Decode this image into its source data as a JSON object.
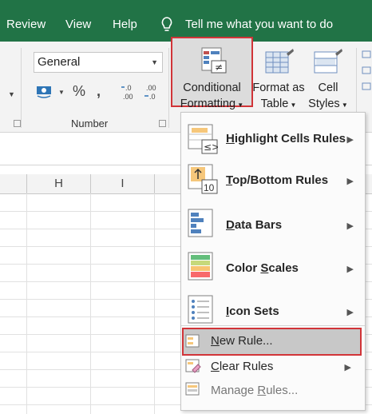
{
  "tabs": [
    "Review",
    "View",
    "Help"
  ],
  "tell_me": "Tell me what you want to do",
  "number_group": {
    "format_value": "General",
    "currency_symbol": "$",
    "percent_symbol": "%",
    "comma_symbol": ",",
    "increase_decimal": "←.0\n.00",
    "decrease_decimal": ".00\n→.0",
    "label": "Number"
  },
  "styles_group": {
    "conditional_formatting": [
      "Conditional",
      "Formatting"
    ],
    "format_as_table": [
      "Format as",
      "Table"
    ],
    "cell_styles": [
      "Cell",
      "Styles"
    ]
  },
  "column_headers": [
    "H",
    "I"
  ],
  "menu": {
    "items": [
      {
        "label": "Highlight Cells Rules",
        "ul": "H",
        "rest": "ighlight Cells Rules",
        "icon": "highlight-cells-rules-icon",
        "submenu": true
      },
      {
        "label": "Top/Bottom Rules",
        "ul": "T",
        "rest": "op/Bottom Rules",
        "icon": "top-bottom-rules-icon",
        "submenu": true
      },
      {
        "label": "Data Bars",
        "ul": "D",
        "rest": "ata Bars",
        "icon": "data-bars-icon",
        "submenu": true
      },
      {
        "label": "Color Scales",
        "pre": "Color ",
        "ul": "S",
        "rest": "cales",
        "icon": "color-scales-icon",
        "submenu": true
      },
      {
        "label": "Icon Sets",
        "ul": "I",
        "rest": "con Sets",
        "icon": "icon-sets-icon",
        "submenu": true
      }
    ],
    "small_items": [
      {
        "label": "New Rule...",
        "pre": "",
        "ul": "N",
        "rest": "ew Rule...",
        "icon": "new-rule-icon",
        "submenu": false,
        "highlighted": true
      },
      {
        "label": "Clear Rules",
        "pre": "",
        "ul": "C",
        "rest": "lear Rules",
        "icon": "clear-rules-icon",
        "submenu": true,
        "highlighted": false
      },
      {
        "label": "Manage Rules...",
        "pre": "Manage ",
        "ul": "R",
        "rest": "ules...",
        "icon": "manage-rules-icon",
        "submenu": false,
        "highlighted": false
      }
    ]
  },
  "colors": {
    "title_green": "#217346",
    "highlight_red": "#d13438",
    "ribbon_bg": "#f3f3f3"
  }
}
